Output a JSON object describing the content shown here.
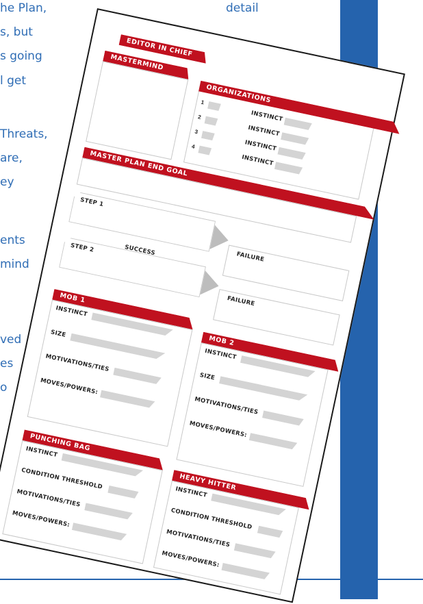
{
  "background_text": {
    "lines": [
      "he Plan,",
      "s, but",
      "s going",
      "l get",
      "Threats,",
      "are,",
      "ey",
      "ents",
      "mind",
      "ved",
      "es",
      "o"
    ],
    "top_right_word": "detail"
  },
  "colors": {
    "accent_red": "#c0111f",
    "blue": "#2563ad",
    "text_blue": "#2f6db5",
    "gray_bar": "#d4d4d4"
  },
  "sheet": {
    "editor": "EDITOR IN CHIEF",
    "mastermind": "MASTERMIND",
    "organizations": {
      "title": "ORGANIZATIONS",
      "rows": [
        {
          "num": "1",
          "label": "INSTINCT"
        },
        {
          "num": "2",
          "label": "INSTINCT"
        },
        {
          "num": "3",
          "label": "INSTINCT"
        },
        {
          "num": "4",
          "label": "INSTINCT"
        }
      ]
    },
    "master_plan": "MASTER PLAN END GOAL",
    "step1": "STEP 1",
    "step2": "STEP 2",
    "failure1": "FAILURE",
    "failure2": "FAILURE",
    "success": "SUCCESS",
    "mob1": {
      "title": "MOB 1",
      "fields": [
        "INSTINCT",
        "SIZE",
        "MOTIVATIONS/TIES",
        "MOVES/POWERS:"
      ]
    },
    "mob2": {
      "title": "MOB 2",
      "fields": [
        "INSTINCT",
        "SIZE",
        "MOTIVATIONS/TIES",
        "MOVES/POWERS:"
      ]
    },
    "punching_bag": {
      "title": "PUNCHING BAG",
      "fields": [
        "INSTINCT",
        "CONDITION THRESHOLD",
        "MOTIVATIONS/TIES",
        "MOVES/POWERS:"
      ]
    },
    "heavy_hitter": {
      "title": "HEAVY HITTER",
      "fields": [
        "INSTINCT",
        "CONDITION THRESHOLD",
        "MOTIVATIONS/TIES",
        "MOVES/POWERS:"
      ]
    }
  }
}
